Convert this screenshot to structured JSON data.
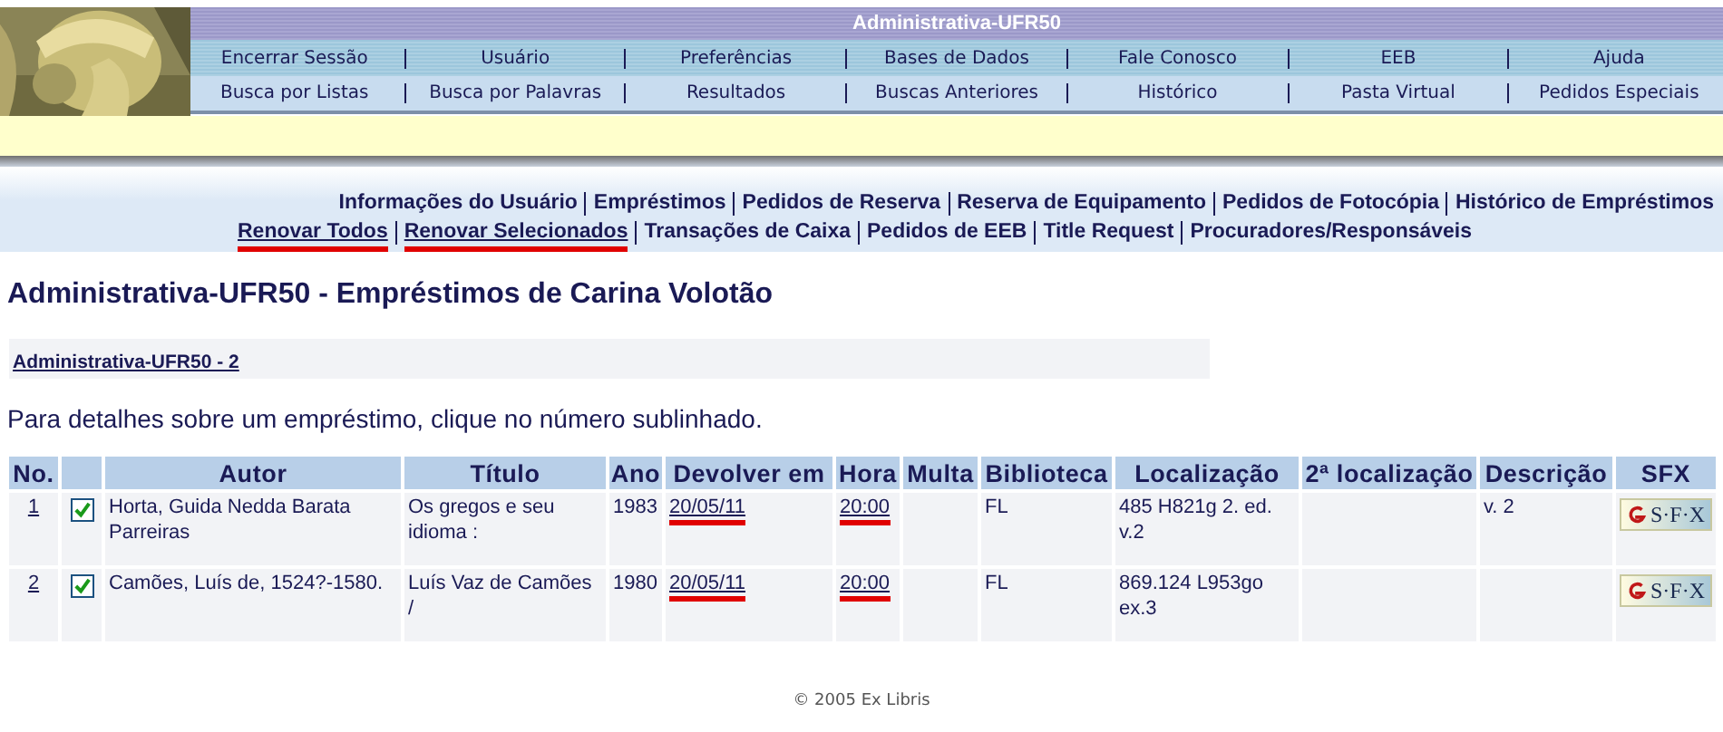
{
  "header": {
    "title": "Administrativa-UFR50",
    "menu_rows": [
      [
        "Encerrar Sessão",
        "Usuário",
        "Preferências",
        "Bases de Dados",
        "Fale Conosco",
        "EEB",
        "Ajuda"
      ],
      [
        "Busca por Listas",
        "Busca por Palavras",
        "Resultados",
        "Buscas Anteriores",
        "Histórico",
        "Pasta Virtual",
        "Pedidos Especiais"
      ]
    ]
  },
  "account_links": [
    [
      {
        "label": "Informações do Usuário",
        "highlighted": false
      },
      {
        "label": "Empréstimos",
        "highlighted": false
      },
      {
        "label": "Pedidos de Reserva",
        "highlighted": false
      },
      {
        "label": "Reserva de Equipamento",
        "highlighted": false
      },
      {
        "label": "Pedidos de Fotocópia",
        "highlighted": false
      },
      {
        "label": "Histórico de Empréstimos",
        "highlighted": false
      }
    ],
    [
      {
        "label": "Renovar Todos",
        "highlighted": true
      },
      {
        "label": "Renovar Selecionados",
        "highlighted": true
      },
      {
        "label": "Transações de Caixa",
        "highlighted": false
      },
      {
        "label": "Pedidos de EEB",
        "highlighted": false
      },
      {
        "label": "Title Request",
        "highlighted": false
      },
      {
        "label": "Procuradores/Responsáveis",
        "highlighted": false
      }
    ]
  ],
  "heading": "Administrativa-UFR50 - Empréstimos de Carina Volotão",
  "sublibrary_link": "Administrativa-UFR50 - 2",
  "instructions": "Para detalhes sobre um empréstimo, clique no número sublinhado.",
  "table": {
    "columns": [
      "No.",
      "",
      "Autor",
      "Título",
      "Ano",
      "Devolver em",
      "Hora",
      "Multa",
      "Biblioteca",
      "Localização",
      "2ª localização",
      "Descrição",
      "SFX"
    ],
    "rows": [
      {
        "no": "1",
        "checked": true,
        "autor": "Horta, Guida Nedda Barata Parreiras",
        "titulo": "Os gregos e seu idioma :",
        "ano": "1983",
        "devolver": "20/05/11",
        "hora": "20:00",
        "highlighted": true,
        "multa": "",
        "biblioteca": "FL",
        "localizacao": "485 H821g 2. ed. v.2",
        "localizacao2": "",
        "descricao": "v. 2",
        "sfx": "S·F·X"
      },
      {
        "no": "2",
        "checked": true,
        "autor": "Camões, Luís de, 1524?-1580.",
        "titulo": "Luís Vaz de Camões /",
        "ano": "1980",
        "devolver": "20/05/11",
        "hora": "20:00",
        "highlighted": true,
        "multa": "",
        "biblioteca": "FL",
        "localizacao": "869.124 L953go ex.3",
        "localizacao2": "",
        "descricao": "",
        "sfx": "S·F·X"
      }
    ]
  },
  "footer": "© 2005 Ex Libris"
}
